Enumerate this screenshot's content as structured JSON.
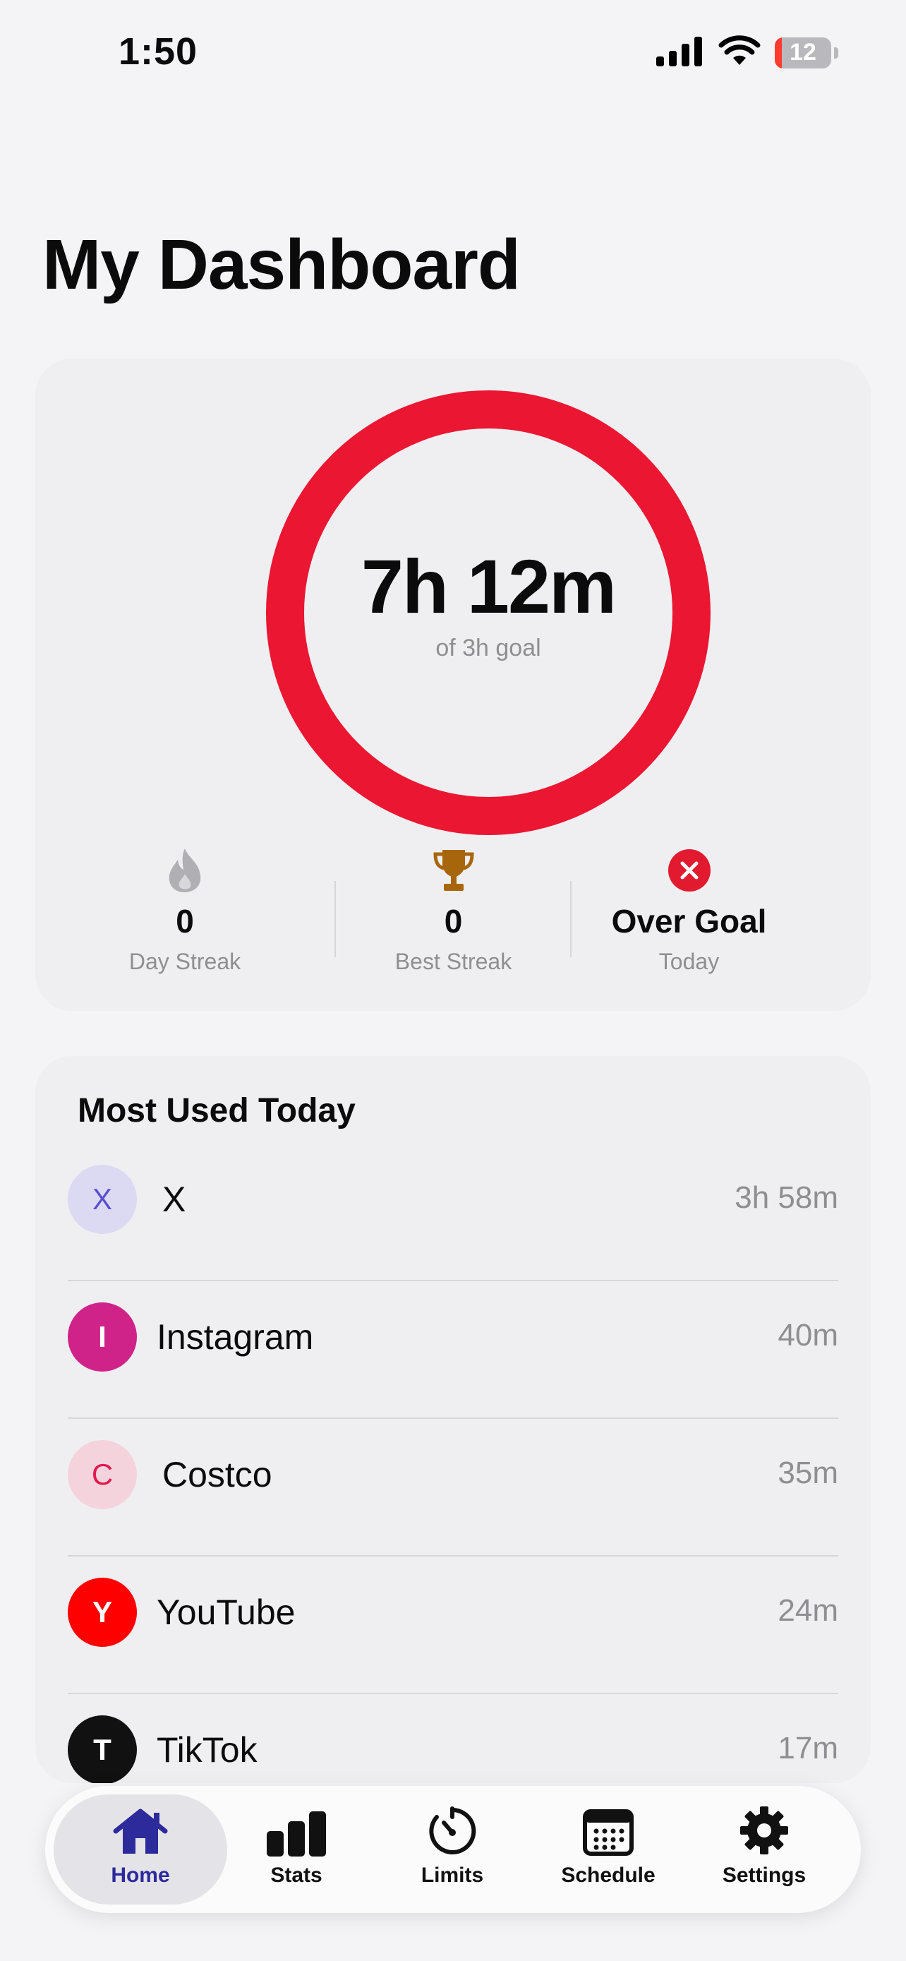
{
  "status_bar": {
    "time": "1:50",
    "battery": "12",
    "icons": [
      "cellular-signal-icon",
      "wifi-icon",
      "battery-icon"
    ]
  },
  "page": {
    "title": "My Dashboard"
  },
  "summary": {
    "usage_value": "7h 12m",
    "goal_text": "of 3h goal",
    "ring_color": "#eb1632",
    "stats": [
      {
        "value": "0",
        "label": "Day Streak",
        "icon": "flame-icon"
      },
      {
        "value": "0",
        "label": "Best Streak",
        "icon": "trophy-icon"
      },
      {
        "value": "Over Goal",
        "label": "Today",
        "icon": "x-circle-icon"
      }
    ]
  },
  "most_used": {
    "title": "Most Used Today",
    "apps": [
      {
        "initial": "X",
        "name": "X",
        "time": "3h 58m",
        "color": "#5a4fcf",
        "bg": "#dcdaf3"
      },
      {
        "initial": "I",
        "name": "Instagram",
        "time": "40m",
        "color": "#ffffff",
        "bg": "#d0238a"
      },
      {
        "initial": "C",
        "name": "Costco",
        "time": "35m",
        "color": "#e3194f",
        "bg": "#f5d3dc"
      },
      {
        "initial": "Y",
        "name": "YouTube",
        "time": "24m",
        "color": "#ffffff",
        "bg": "#ff0000"
      },
      {
        "initial": "T",
        "name": "TikTok",
        "time": "17m",
        "color": "#ffffff",
        "bg": "#111111"
      }
    ]
  },
  "tab_bar": {
    "active_color": "#2d2a9c",
    "tabs": [
      {
        "label": "Home",
        "icon": "house-icon",
        "active": true
      },
      {
        "label": "Stats",
        "icon": "bar-chart-icon",
        "active": false
      },
      {
        "label": "Limits",
        "icon": "timer-icon",
        "active": false
      },
      {
        "label": "Schedule",
        "icon": "calendar-icon",
        "active": false
      },
      {
        "label": "Settings",
        "icon": "gear-icon",
        "active": false
      }
    ]
  }
}
